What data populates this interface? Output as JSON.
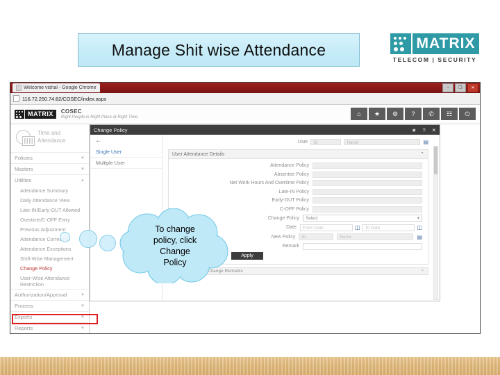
{
  "slide": {
    "title": "Manage Shit wise Attendance",
    "logo": {
      "word": "MATRIX",
      "tagline": "TELECOM | SECURITY"
    }
  },
  "browser": {
    "tab_title": "Welcome vishal - Google Chrome",
    "url": "116.72.250.74:82/COSEC/index.aspx",
    "window_controls": {
      "minimize": "–",
      "maximize": "❐",
      "close": "✕"
    }
  },
  "app_header": {
    "brand": "MATRIX",
    "product": "COSEC",
    "tagline": "Right People in Right Place at Right Time",
    "icons": [
      {
        "name": "home-icon",
        "glyph": "⌂"
      },
      {
        "name": "favorite-icon",
        "glyph": "★"
      },
      {
        "name": "settings-icon",
        "glyph": "⚙"
      },
      {
        "name": "help-icon",
        "glyph": "?"
      },
      {
        "name": "phone-icon",
        "glyph": "✆"
      },
      {
        "name": "report-icon",
        "glyph": "☷"
      },
      {
        "name": "logout-icon",
        "glyph": "⏻"
      }
    ]
  },
  "sidebar": {
    "module": "Time and Attendance",
    "groups": [
      {
        "label": "Policies",
        "caret": "▼"
      },
      {
        "label": "Masters",
        "caret": "▼"
      },
      {
        "label": "Utilities",
        "caret": "▲"
      }
    ],
    "items": [
      "Attendance Summary",
      "Daily Attendance View",
      "Late-IN/Early-OUT Allowed",
      "Overtime/C-OFF Entry",
      "Previous Adjustment",
      "Attendance Correction",
      "Attendance Exceptions",
      "Shift-Wise Management",
      "Change Policy",
      "User-Wise Attendance Restriction"
    ],
    "selected_item": "Change Policy",
    "bottom_groups": [
      {
        "label": "Authorization/Approval",
        "caret": "▼"
      },
      {
        "label": "Process",
        "caret": "▼"
      },
      {
        "label": "Exports",
        "caret": "▼"
      },
      {
        "label": "Reports",
        "caret": "▼"
      }
    ]
  },
  "dialog": {
    "title": "Change Policy",
    "actions": {
      "favorite": "★",
      "help": "?",
      "close": "✕"
    },
    "back_arrow": "←",
    "tabs": [
      {
        "label": "Single User",
        "active": true
      },
      {
        "label": "Multiple User",
        "active": false
      }
    ],
    "user_row": {
      "label": "User",
      "id_placeholder": "ID",
      "name_placeholder": "Name",
      "picker_icon": "▤"
    },
    "panel": {
      "heading": "User Attendance Details",
      "collapse_icon": "⌃",
      "fields": [
        "Attendance Policy",
        "Absentee Policy",
        "Net Work Hours And Overtime Policy",
        "Late-IN Policy",
        "Early-OUT Policy",
        "C-OFF Policy"
      ],
      "change_policy": {
        "label": "Change Policy",
        "value": "Select",
        "caret": "▾"
      },
      "date": {
        "label": "Date",
        "from_placeholder": "From Date",
        "to_placeholder": "To Date",
        "calendar_icon": "📅"
      },
      "new_policy": {
        "label": "New Policy",
        "id_placeholder": "ID",
        "name_placeholder": "Name",
        "picker_icon": "▤"
      },
      "remark": {
        "label": "Remark",
        "value": ""
      },
      "apply_button": "Apply"
    },
    "collapsed_section": {
      "label": "User Attendance Change Remarks",
      "caret": "⌃"
    }
  },
  "callout": {
    "line1": "To change",
    "line2": "policy, click",
    "line3": "Change",
    "line4": "Policy"
  },
  "colors": {
    "title_bg": "#c6ecf8",
    "brand_teal": "#2e9aa6",
    "highlight_red": "#e02020",
    "cloud_blue": "#bfe9f7",
    "wood": "#e0b87b"
  }
}
